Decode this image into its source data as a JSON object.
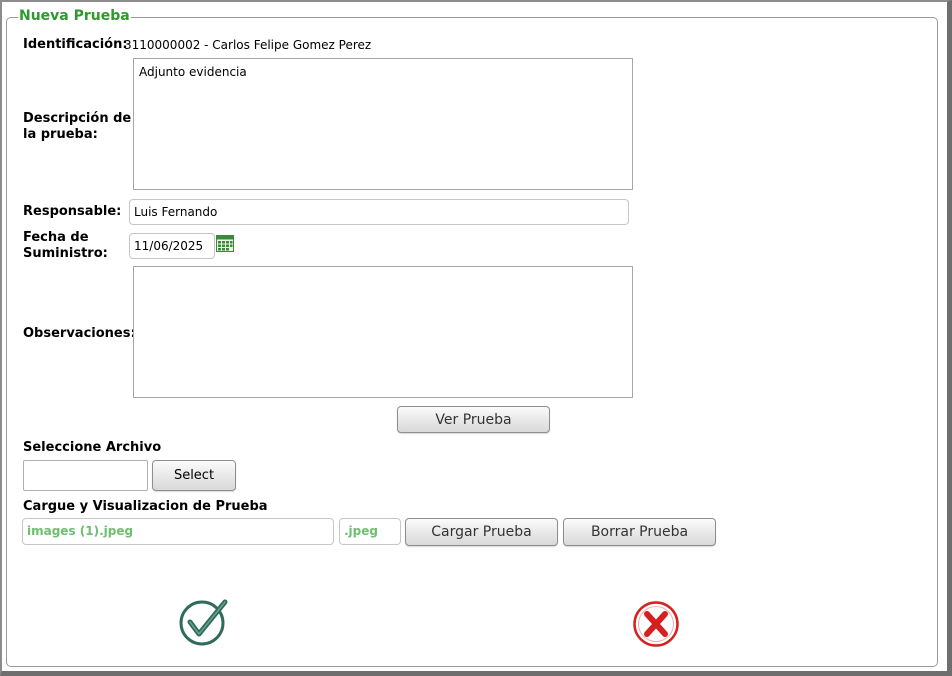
{
  "form": {
    "legend": "Nueva Prueba",
    "identificacion_label": "Identificación:",
    "identificacion_value": "3110000002 - Carlos Felipe Gomez Perez",
    "descripcion_label_1": "Descripción de",
    "descripcion_label_2": "la prueba:",
    "descripcion_value": "Adjunto evidencia",
    "responsable_label": "Responsable:",
    "responsable_value": "Luis Fernando",
    "fecha_label_1": "Fecha de",
    "fecha_label_2": "Suministro:",
    "fecha_value": "11/06/2025",
    "observaciones_label": "Observaciones:",
    "observaciones_value": "",
    "ver_prueba_button": "Ver Prueba",
    "seleccione_label": "Seleccione Archivo",
    "archivo_value": "",
    "select_button": "Select",
    "cargue_label": "Cargue y Visualizacion de Prueba",
    "file_name": "images (1).jpeg",
    "file_ext": ".jpeg",
    "cargar_button": "Cargar Prueba",
    "borrar_button": "Borrar Prueba"
  },
  "icons": {
    "calendar": "calendar-icon",
    "accept": "check-circle-icon",
    "cancel": "x-circle-icon"
  },
  "colors": {
    "legend": "#2e9a2e",
    "file_text": "#6fbf6f",
    "accept": "#2f6b5a",
    "cancel": "#d62020"
  }
}
